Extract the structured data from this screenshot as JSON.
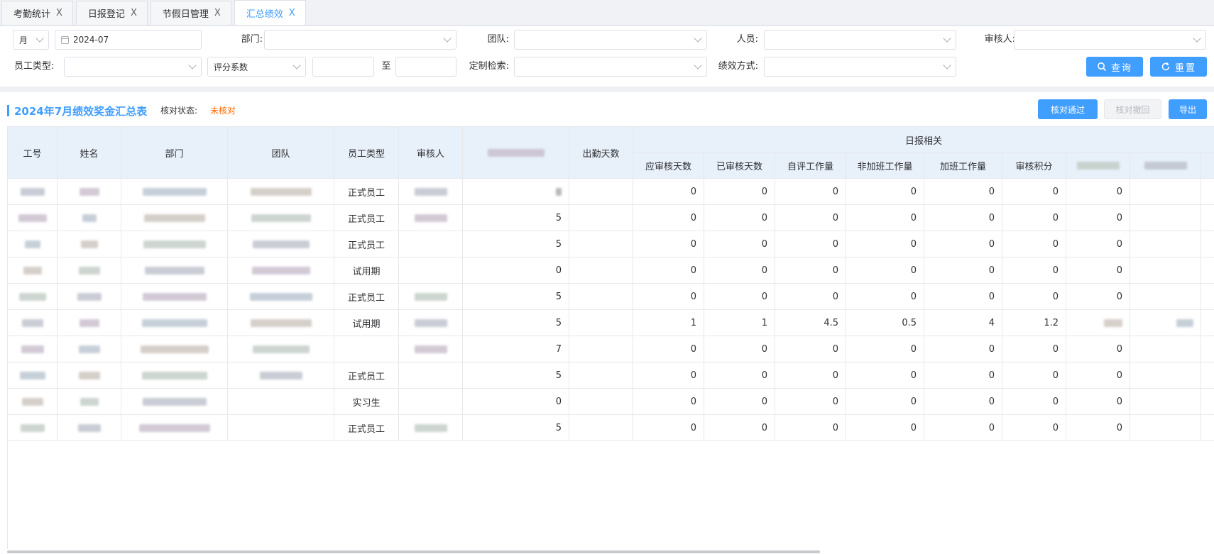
{
  "tabs": [
    {
      "label": "考勤统计",
      "active": false
    },
    {
      "label": "日报登记",
      "active": false
    },
    {
      "label": "节假日管理",
      "active": false
    },
    {
      "label": "汇总绩效",
      "active": true
    }
  ],
  "filters": {
    "period_type": "月",
    "date": "2024-07",
    "dept_label": "部门:",
    "team_label": "团队:",
    "person_label": "人员:",
    "reviewer_label": "审核人:",
    "emp_type_label": "员工类型:",
    "score_select": "评分系数",
    "range_to": "至",
    "custom_search_label": "定制检索:",
    "perf_mode_label": "绩效方式:",
    "query_button": "查询",
    "reset_button": "重置"
  },
  "panel": {
    "title": "2024年7月绩效奖金汇总表",
    "status_label": "核对状态:",
    "status_value": "未核对",
    "approve_button": "核对通过",
    "revoke_button": "核对撤回",
    "export_button": "导出"
  },
  "table": {
    "headers": {
      "id": "工号",
      "name": "姓名",
      "dept": "部门",
      "team": "团队",
      "emp_type": "员工类型",
      "reviewer": "审核人",
      "attendance": "出勤天数",
      "daily_group": "日报相关",
      "should_review": "应审核天数",
      "reviewed": "已审核天数",
      "self_eval": "自评工作量",
      "non_overtime": "非加班工作量",
      "overtime": "加班工作量",
      "review_score": "审核积分"
    },
    "rows": [
      {
        "emp_type": "正式员工",
        "col7": "",
        "should": "0",
        "reviewed": "0",
        "self": "0",
        "non_ot": "0",
        "ot": "0",
        "score": "0",
        "col14": "0"
      },
      {
        "emp_type": "正式员工",
        "col7": "5",
        "should": "0",
        "reviewed": "0",
        "self": "0",
        "non_ot": "0",
        "ot": "0",
        "score": "0",
        "col14": "0"
      },
      {
        "emp_type": "正式员工",
        "col7": "5",
        "should": "0",
        "reviewed": "0",
        "self": "0",
        "non_ot": "0",
        "ot": "0",
        "score": "0",
        "col14": "0"
      },
      {
        "emp_type": "试用期",
        "col7": "0",
        "should": "0",
        "reviewed": "0",
        "self": "0",
        "non_ot": "0",
        "ot": "0",
        "score": "0",
        "col14": "0"
      },
      {
        "emp_type": "正式员工",
        "col7": "5",
        "should": "0",
        "reviewed": "0",
        "self": "0",
        "non_ot": "0",
        "ot": "0",
        "score": "0",
        "col14": "0"
      },
      {
        "emp_type": "试用期",
        "col7": "5",
        "should": "1",
        "reviewed": "1",
        "self": "4.5",
        "non_ot": "0.5",
        "ot": "4",
        "score": "1.2",
        "col14": ""
      },
      {
        "emp_type": "",
        "col7": "7",
        "should": "0",
        "reviewed": "0",
        "self": "0",
        "non_ot": "0",
        "ot": "0",
        "score": "0",
        "col14": "0"
      },
      {
        "emp_type": "正式员工",
        "col7": "5",
        "should": "0",
        "reviewed": "0",
        "self": "0",
        "non_ot": "0",
        "ot": "0",
        "score": "0",
        "col14": "0"
      },
      {
        "emp_type": "实习生",
        "col7": "0",
        "should": "0",
        "reviewed": "0",
        "self": "0",
        "non_ot": "0",
        "ot": "0",
        "score": "0",
        "col14": "0"
      },
      {
        "emp_type": "正式员工",
        "col7": "5",
        "should": "0",
        "reviewed": "0",
        "self": "0",
        "non_ot": "0",
        "ot": "0",
        "score": "0",
        "col14": "0"
      }
    ]
  },
  "colors": {
    "accent": "#409eff",
    "header_bg": "#e8f0fa",
    "status_warning": "#ff6a00"
  }
}
